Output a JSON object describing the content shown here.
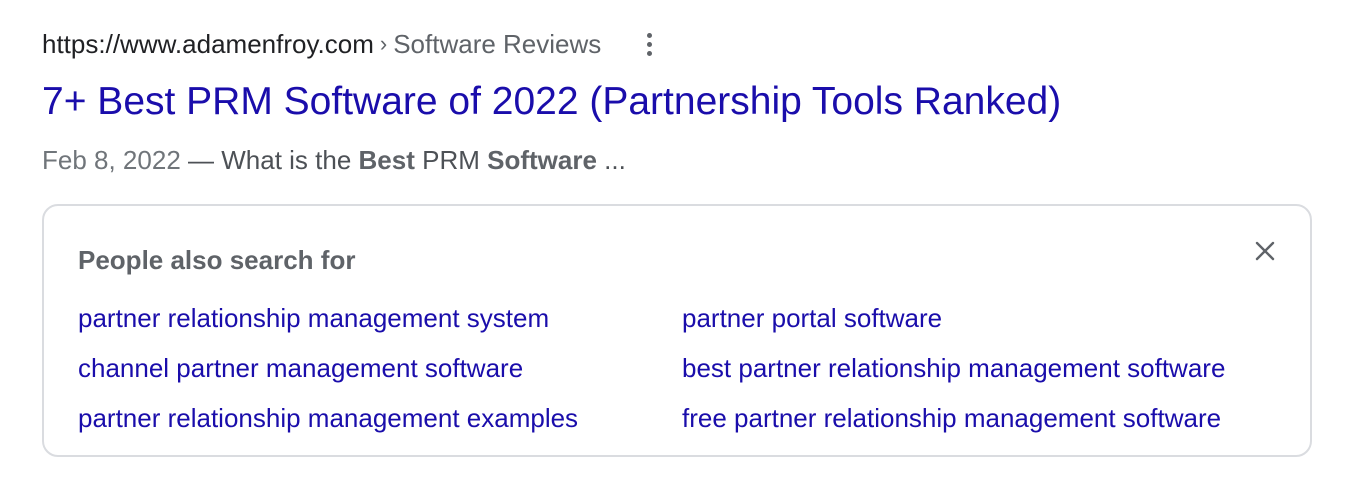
{
  "result": {
    "url": {
      "domain": "https://www.adamenfroy.com",
      "separator": "›",
      "breadcrumb": "Software Reviews"
    },
    "title": "7+ Best PRM Software of 2022 (Partnership Tools Ranked)",
    "snippet": {
      "date": "Feb 8, 2022",
      "dash": " — ",
      "text_1": "What is the ",
      "bold_1": "Best",
      "text_2": " PRM ",
      "bold_2": "Software",
      "text_3": " ..."
    }
  },
  "people_also_search": {
    "heading": "People also search for",
    "close_icon": "close-icon",
    "links": [
      "partner relationship management system",
      "partner portal software",
      "channel partner management software",
      "best partner relationship management software",
      "partner relationship management examples",
      "free partner relationship management software"
    ]
  },
  "colors": {
    "link": "#1a0dab",
    "text": "#202124",
    "muted": "#5f6368",
    "border": "#dadce0"
  }
}
